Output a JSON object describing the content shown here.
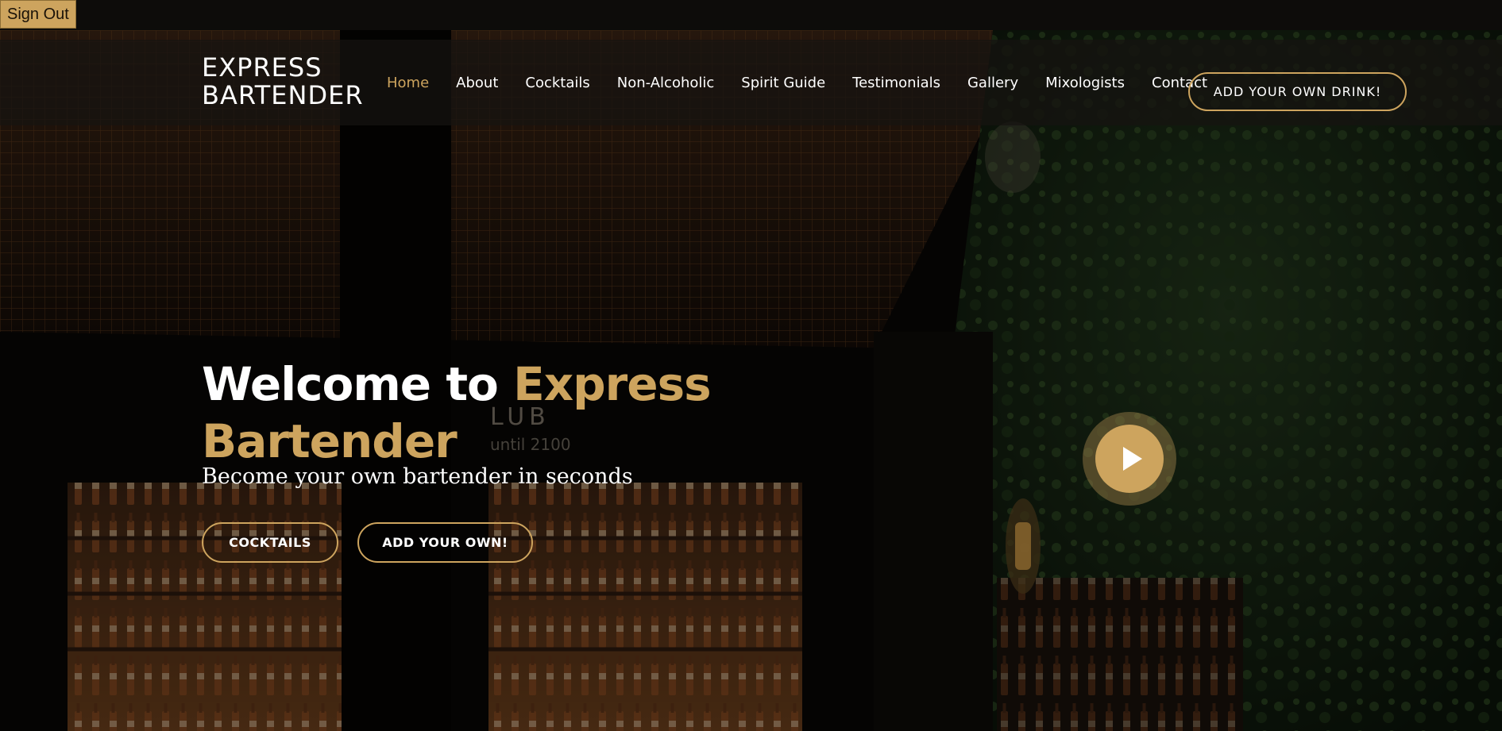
{
  "topbar": {
    "signout_label": "Sign Out"
  },
  "navbar": {
    "logo_line1": "EXPRESS",
    "logo_line2": "BARTENDER",
    "items": [
      {
        "label": "Home",
        "active": true
      },
      {
        "label": "About"
      },
      {
        "label": "Cocktails"
      },
      {
        "label": "Non-Alcoholic"
      },
      {
        "label": "Spirit Guide"
      },
      {
        "label": "Testimonials"
      },
      {
        "label": "Gallery"
      },
      {
        "label": "Mixologists"
      },
      {
        "label": "Contact"
      }
    ],
    "cta_label": "ADD YOUR OWN DRINK!"
  },
  "hero": {
    "title_part1": "Welcome to ",
    "title_part2": "Express Bartender",
    "subtitle": "Become your own bartender in seconds",
    "buttons": {
      "cocktails_label": "COCKTAILS",
      "add_label": "ADD YOUR OWN!"
    },
    "background_sign": "LUB",
    "background_sign_sub": "until 2100"
  },
  "colors": {
    "accent": "#cda45e",
    "background": "#0c0b09",
    "text": "#ffffff"
  },
  "icons": {
    "play": "play-icon"
  }
}
